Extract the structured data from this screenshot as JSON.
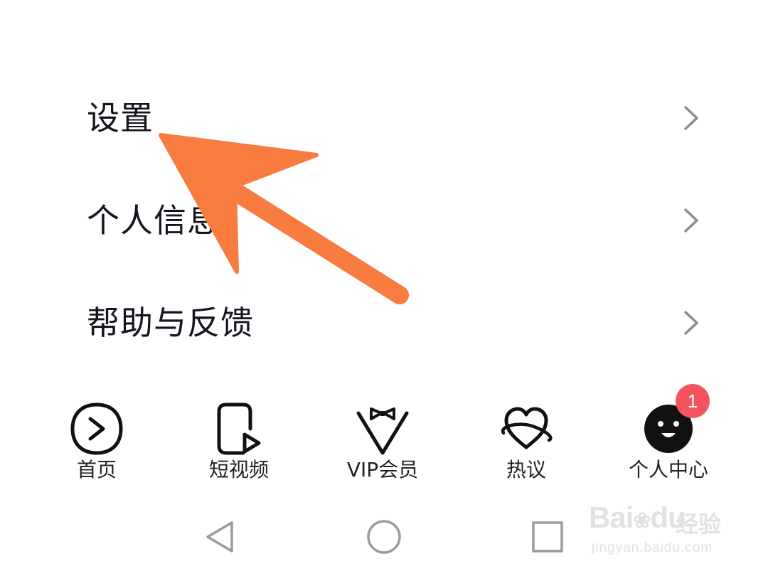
{
  "menu": {
    "items": [
      {
        "label": "设置"
      },
      {
        "label": "个人信息"
      },
      {
        "label": "帮助与反馈"
      }
    ]
  },
  "tabbar": {
    "tabs": [
      {
        "label": "首页",
        "icon": "play-circle-icon"
      },
      {
        "label": "短视频",
        "icon": "short-video-icon"
      },
      {
        "label": "VIP会员",
        "icon": "bowtie-vip-icon"
      },
      {
        "label": "热议",
        "icon": "heart-planet-icon"
      },
      {
        "label": "个人中心",
        "icon": "smiley-avatar-icon"
      }
    ],
    "badge_count": "1"
  },
  "watermark": {
    "logo": "Bai",
    "logo_suffix": "du",
    "name": "经验",
    "url": "jingyan.baidu.com"
  },
  "colors": {
    "arrow": "#f87b3f",
    "badge": "#f2555f",
    "text": "#15151f",
    "chevron": "#8c8c8c"
  }
}
